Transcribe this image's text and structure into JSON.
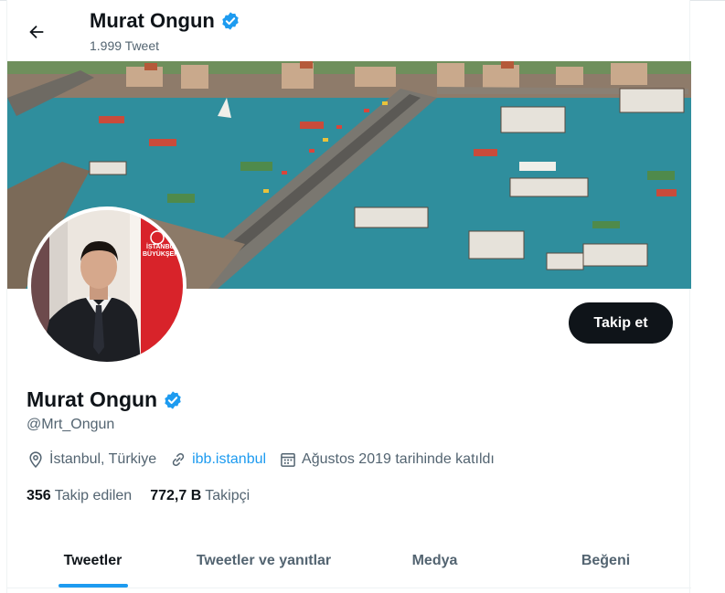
{
  "colors": {
    "accent": "#1d9bf0",
    "text": "#0f1419",
    "muted": "#536471",
    "button_bg": "#0f1419"
  },
  "header": {
    "name": "Murat Ongun",
    "tweet_count": "1.999 Tweet",
    "back_icon": "arrow-left-icon"
  },
  "profile": {
    "name": "Murat Ongun",
    "verified_icon": "verified-badge-icon",
    "handle": "@Mrt_Ongun",
    "follow_label": "Takip et",
    "location": "İstanbul, Türkiye",
    "website": "ibb.istanbul",
    "joined": "Ağustos 2019 tarihinde katıldı",
    "following_count": "356",
    "following_label": "Takip edilen",
    "followers_count": "772,7 B",
    "followers_label": "Takipçi"
  },
  "tabs": [
    {
      "label": "Tweetler",
      "active": true
    },
    {
      "label": "Tweetler ve yanıtlar",
      "active": false
    },
    {
      "label": "Medya",
      "active": false
    },
    {
      "label": "Beğeni",
      "active": false
    }
  ]
}
